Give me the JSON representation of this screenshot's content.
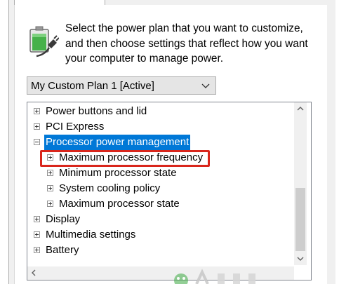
{
  "intro_text": "Select the power plan that you want to customize, and then choose settings that reflect how you want your computer to manage power.",
  "plan_select": {
    "value": "My Custom Plan 1 [Active]"
  },
  "tree": {
    "items": [
      {
        "label": "Power buttons and lid",
        "expander": "plus"
      },
      {
        "label": "PCI Express",
        "expander": "plus"
      },
      {
        "label": "Processor power management",
        "expander": "minus",
        "selected": true
      },
      {
        "label": "Maximum processor frequency",
        "expander": "plus",
        "highlighted": true
      },
      {
        "label": "Minimum processor state",
        "expander": "plus"
      },
      {
        "label": "System cooling policy",
        "expander": "plus"
      },
      {
        "label": "Maximum processor state",
        "expander": "plus"
      },
      {
        "label": "Display",
        "expander": "plus"
      },
      {
        "label": "Multimedia settings",
        "expander": "plus"
      },
      {
        "label": "Battery",
        "expander": "plus"
      }
    ]
  },
  "colors": {
    "selection": "#0078d7",
    "highlight_box": "#d9261c",
    "battery_green": "#46b14a"
  },
  "icons": {
    "battery": "battery-plug-icon",
    "dropdown": "chevron-down-icon",
    "scroll_up": "scroll-up-arrow-icon",
    "scroll_down": "scroll-down-arrow-icon",
    "scroll_left": "scroll-left-arrow-icon"
  }
}
